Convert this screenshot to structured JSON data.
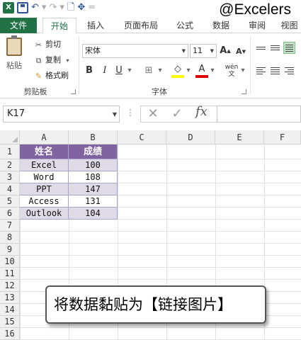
{
  "watermark": "@Excelers",
  "ribbon_tabs": [
    {
      "label": "文件"
    },
    {
      "label": "开始"
    },
    {
      "label": "插入"
    },
    {
      "label": "页面布局"
    },
    {
      "label": "公式"
    },
    {
      "label": "数据"
    },
    {
      "label": "审阅"
    },
    {
      "label": "视图"
    }
  ],
  "active_tab": "开始",
  "clipboard": {
    "paste_label": "粘贴",
    "cut_label": "剪切",
    "copy_label": "复制",
    "format_painter_label": "格式刷",
    "group_label": "剪贴板"
  },
  "font": {
    "name": "宋体",
    "size": "11",
    "group_label": "字体",
    "bold": "B",
    "italic": "I",
    "underline": "U",
    "grow": "A",
    "shrink": "A",
    "pinyin": "wén"
  },
  "formula_bar": {
    "name_box": "K17",
    "fx": "fx",
    "formula": ""
  },
  "grid": {
    "columns": [
      "A",
      "B",
      "C",
      "D",
      "E",
      "F"
    ],
    "rows": [
      "1",
      "2",
      "3",
      "4",
      "5",
      "6",
      "7",
      "8",
      "9",
      "10",
      "11",
      "12",
      "13",
      "14",
      "15",
      "16"
    ],
    "table": {
      "headers": [
        "姓名",
        "成绩"
      ],
      "rows": [
        [
          "Excel",
          "100"
        ],
        [
          "Word",
          "108"
        ],
        [
          "PPT",
          "147"
        ],
        [
          "Access",
          "131"
        ],
        [
          "Outlook",
          "104"
        ]
      ]
    }
  },
  "callout_text": "将数据黏贴为【链接图片】",
  "colors": {
    "excel_green": "#217346",
    "table_header": "#8064a2",
    "table_band": "#dfd9e8"
  }
}
